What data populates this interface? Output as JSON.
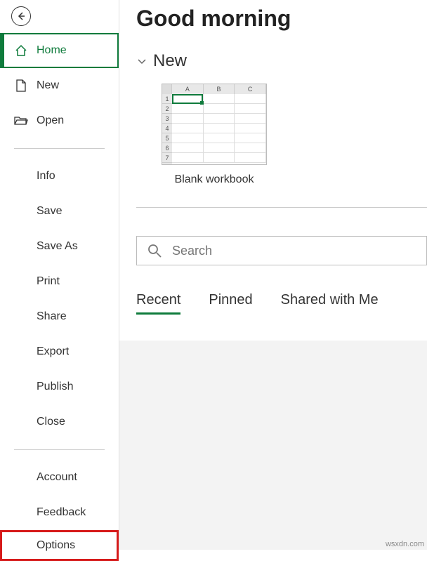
{
  "sidebar": {
    "items": [
      {
        "label": "Home",
        "icon": "home-icon"
      },
      {
        "label": "New",
        "icon": "document-icon"
      },
      {
        "label": "Open",
        "icon": "folder-open-icon"
      }
    ],
    "sub_items_1": [
      {
        "label": "Info"
      },
      {
        "label": "Save"
      },
      {
        "label": "Save As"
      },
      {
        "label": "Print"
      },
      {
        "label": "Share"
      },
      {
        "label": "Export"
      },
      {
        "label": "Publish"
      },
      {
        "label": "Close"
      }
    ],
    "sub_items_2": [
      {
        "label": "Account"
      },
      {
        "label": "Feedback"
      },
      {
        "label": "Options"
      }
    ]
  },
  "main": {
    "greeting": "Good morning",
    "section_new": "New",
    "templates": [
      {
        "label": "Blank workbook",
        "cols": [
          "A",
          "B",
          "C"
        ],
        "rows": [
          "1",
          "2",
          "3",
          "4",
          "5",
          "6",
          "7"
        ]
      }
    ],
    "search_placeholder": "Search",
    "tabs": [
      {
        "label": "Recent",
        "active": true
      },
      {
        "label": "Pinned",
        "active": false
      },
      {
        "label": "Shared with Me",
        "active": false
      }
    ]
  },
  "watermark": "wsxdn.com",
  "colors": {
    "accent": "#0f7b3c",
    "highlight": "#d61a1a"
  }
}
